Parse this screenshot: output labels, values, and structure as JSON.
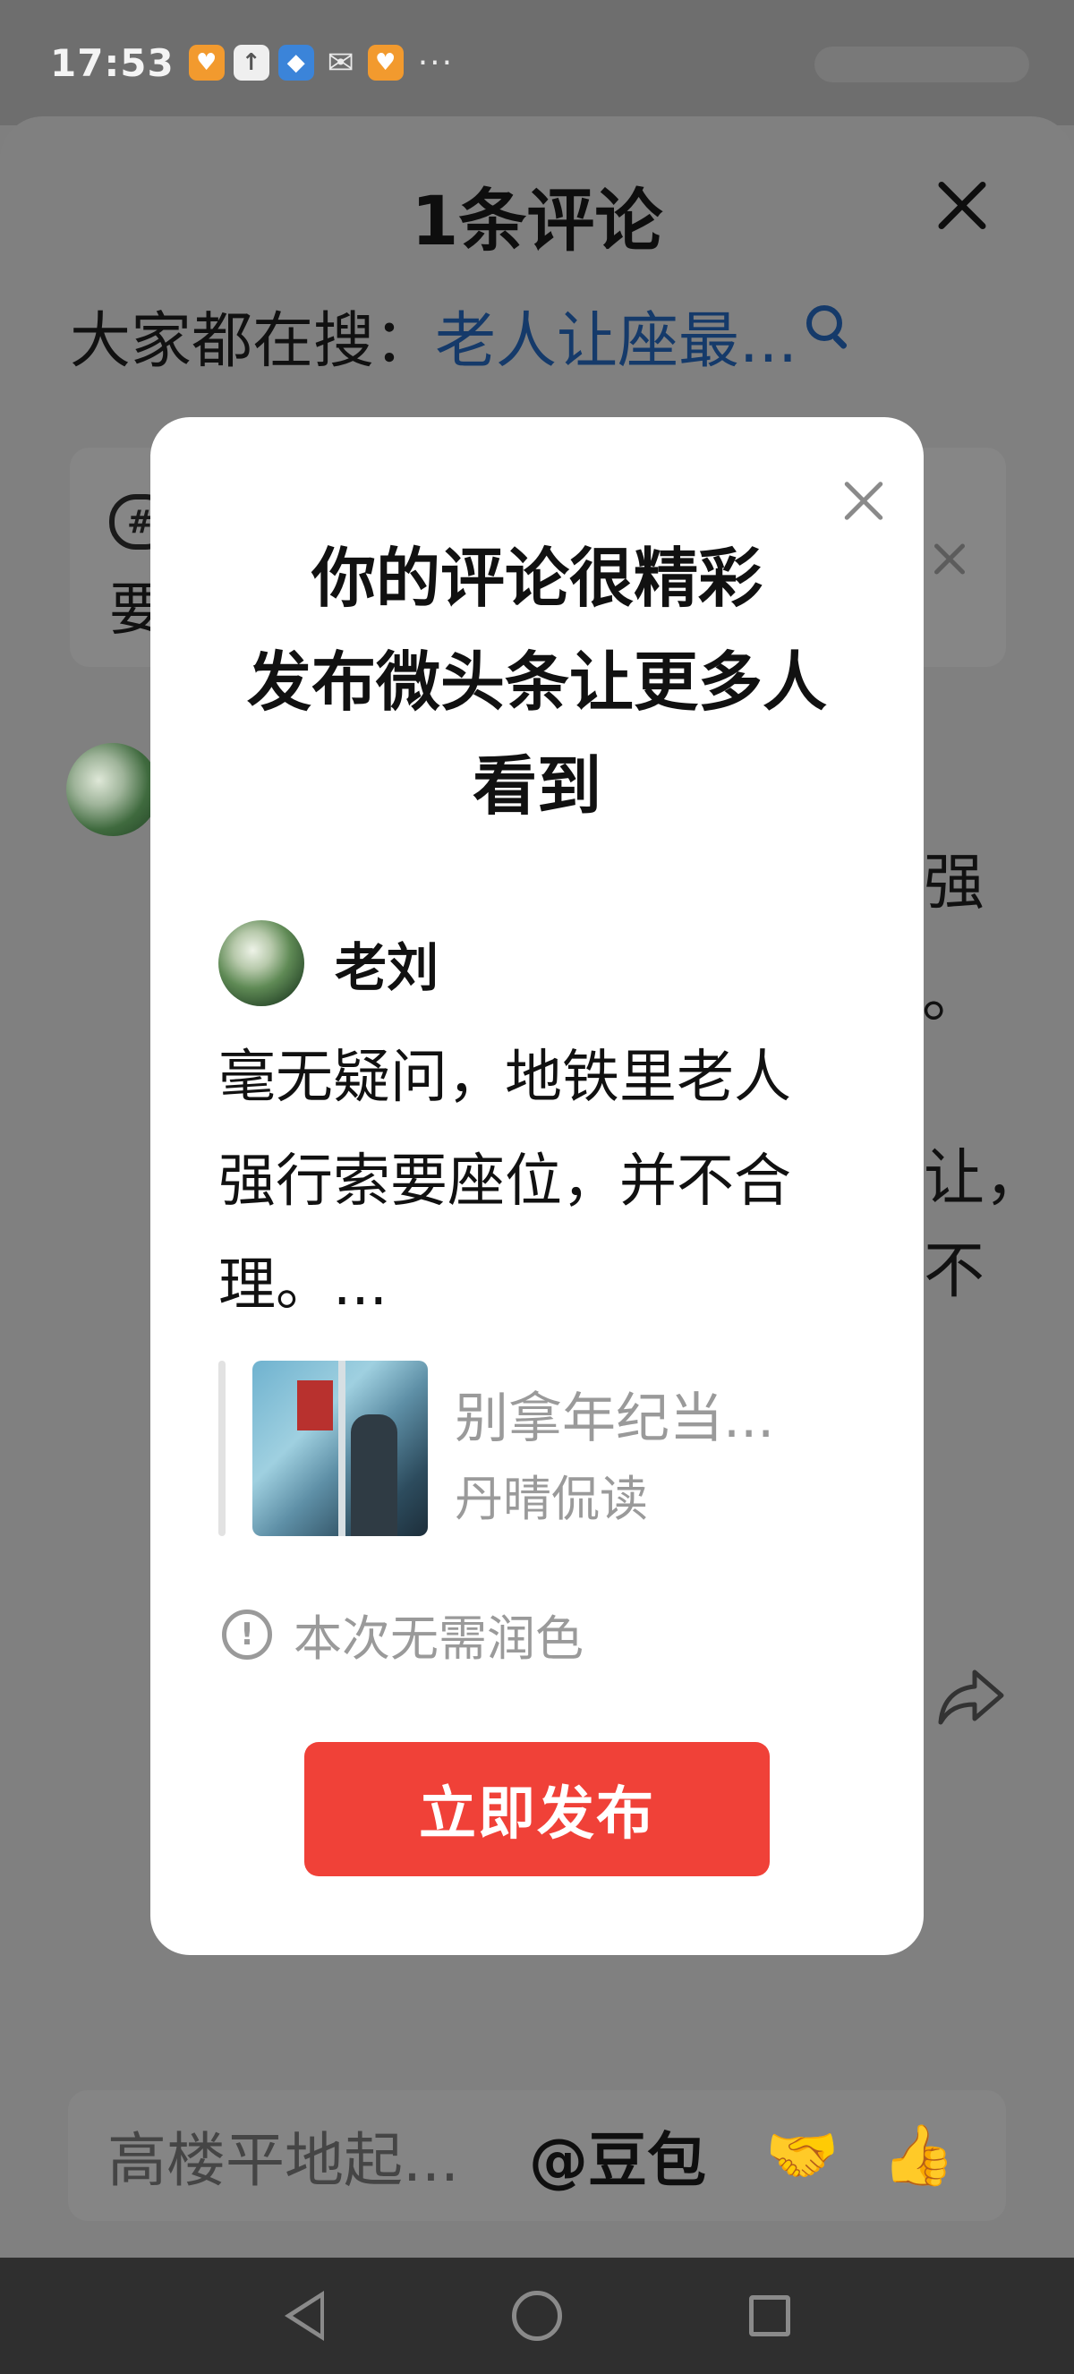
{
  "status_bar": {
    "time": "17:53",
    "icons": [
      "app-orange-icon",
      "upload-icon",
      "browser-icon",
      "wechat-icon",
      "app-orange-icon"
    ],
    "more": "···"
  },
  "comments_sheet": {
    "title": "1条评论",
    "search_prefix": "大家都在搜：",
    "search_term": "老人让座最...",
    "hint_card": {
      "icon_label": "#",
      "text_fragment": "要"
    },
    "background_text": {
      "line1": "强",
      "line2": "。",
      "line3": "让，",
      "line4": "不"
    },
    "input": {
      "placeholder": "高楼平地起...",
      "mention": "@豆包",
      "emoji_1": "🤝",
      "emoji_2": "👍"
    }
  },
  "modal": {
    "title_lines": [
      "你的评论很精彩",
      "发布微头条让更多人",
      "看到"
    ],
    "author": "老刘",
    "comment_lines": [
      "毫无疑问，地铁里老人",
      "强行索要座位，并不合",
      "理。..."
    ],
    "quote": {
      "title": "别拿年纪当...",
      "author": "丹晴侃读"
    },
    "notice": "本次无需润色",
    "publish_button": "立即发布"
  },
  "colors": {
    "accent_red": "#f04138",
    "link_blue": "#153a6a",
    "overlay_gray": "#808080"
  }
}
